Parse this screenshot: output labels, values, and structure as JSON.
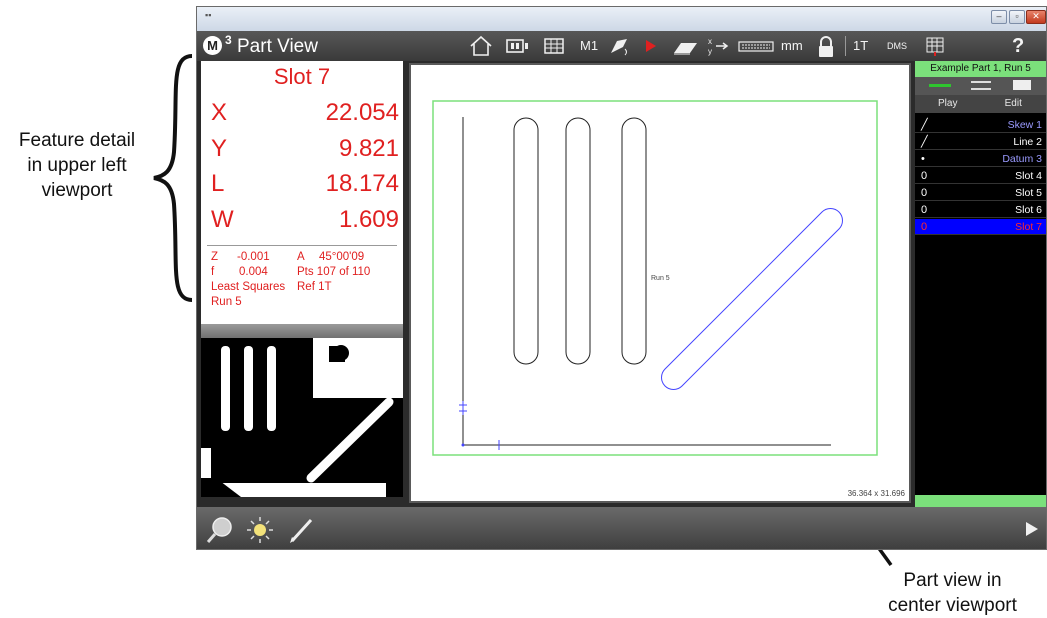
{
  "annotations": {
    "left_lines": [
      "Feature detail",
      "in upper left",
      "viewport"
    ],
    "right_lines": [
      "Part view in",
      "center viewport"
    ]
  },
  "toolbar": {
    "logo_letter": "M",
    "logo_sup": "3",
    "title": "Part View",
    "m1_label": "M1",
    "units_label": "mm",
    "tolerance_label": "1T",
    "angle_format_label": "DMS",
    "help_label": "?"
  },
  "feature": {
    "title": "Slot 7",
    "values": [
      {
        "key": "X",
        "value": "22.054"
      },
      {
        "key": "Y",
        "value": "9.821"
      },
      {
        "key": "L",
        "value": "18.174"
      },
      {
        "key": "W",
        "value": "1.609"
      }
    ],
    "details": {
      "z_key": "Z",
      "z_val": "-0.001",
      "a_key": "A",
      "a_val": "45°00'09",
      "f_key": "f",
      "f_val": "0.004",
      "pts": "Pts 107 of 110",
      "fit": "Least Squares",
      "ref": "Ref 1T",
      "run": "Run 5"
    }
  },
  "center": {
    "run_label": "Run 5",
    "dims": "36.364 x 31.696"
  },
  "right_panel": {
    "header": "Example Part 1, Run 5",
    "tabs": [
      "Play",
      "Edit"
    ],
    "features": [
      {
        "icon": "line",
        "name": "Skew 1",
        "color": "#9a9aff"
      },
      {
        "icon": "line",
        "name": "Line 2",
        "color": "#ffffff"
      },
      {
        "icon": "dot",
        "name": "Datum 3",
        "color": "#9a9aff"
      },
      {
        "icon": "slot",
        "name": "Slot 4",
        "color": "#ffffff"
      },
      {
        "icon": "slot",
        "name": "Slot 5",
        "color": "#ffffff"
      },
      {
        "icon": "slot",
        "name": "Slot 6",
        "color": "#ffffff"
      },
      {
        "icon": "slot",
        "name": "Slot 7",
        "color": "#ff2a2a",
        "selected": true
      }
    ]
  },
  "colors": {
    "measure_red": "#e02020",
    "selection_blue": "#0000ff",
    "accent_green": "#7be07b"
  }
}
